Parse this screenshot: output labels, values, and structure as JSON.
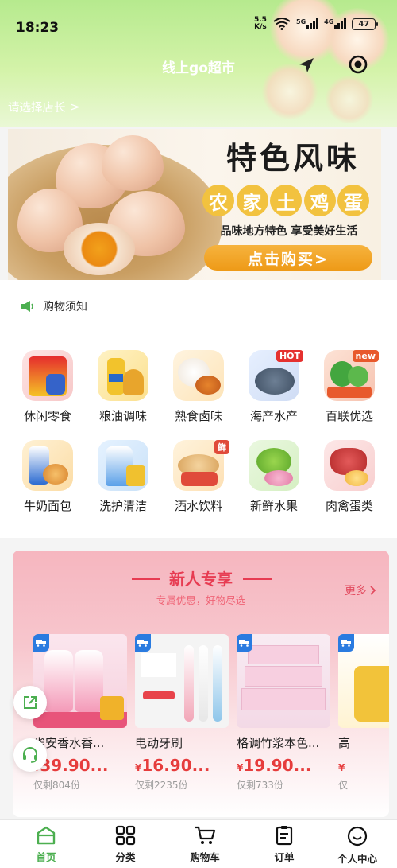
{
  "status_bar": {
    "time": "18:23",
    "net_speed_value": "5.5",
    "net_speed_unit": "K/s",
    "battery": "47",
    "network_labels": [
      "5G",
      "4G"
    ]
  },
  "header": {
    "title": "线上go超市",
    "store_select": "请选择店长",
    "chevron": ">"
  },
  "banner": {
    "title": "特色风味",
    "subtitle_chars": [
      "农",
      "家",
      "土",
      "鸡",
      "蛋"
    ],
    "slogan": "品味地方特色 享受美好生活",
    "cta": "点击购买>"
  },
  "notice": {
    "text": "购物须知"
  },
  "categories": [
    {
      "label": "休闲零食",
      "icon": "snacks-icon",
      "tag": ""
    },
    {
      "label": "粮油调味",
      "icon": "grain-oil-icon",
      "tag": ""
    },
    {
      "label": "熟食卤味",
      "icon": "cooked-food-icon",
      "tag": ""
    },
    {
      "label": "海产水产",
      "icon": "seafood-icon",
      "tag": "HOT"
    },
    {
      "label": "百联优选",
      "icon": "vegetables-icon",
      "tag": "new"
    },
    {
      "label": "牛奶面包",
      "icon": "milk-bread-icon",
      "tag": ""
    },
    {
      "label": "洗护清洁",
      "icon": "detergent-icon",
      "tag": ""
    },
    {
      "label": "酒水饮料",
      "icon": "drinks-icon",
      "tag": "鲜"
    },
    {
      "label": "新鲜水果",
      "icon": "fruit-icon",
      "tag": ""
    },
    {
      "label": "肉禽蛋类",
      "icon": "meat-egg-icon",
      "tag": ""
    }
  ],
  "new_user": {
    "title": "新人专享",
    "subtitle": "专属优惠，好物尽选",
    "more": "更多",
    "products": [
      {
        "name": "雀安香水香...",
        "yen": "¥",
        "price": "39.90...",
        "stock": "仅剩804份"
      },
      {
        "name": "电动牙刷",
        "yen": "¥",
        "price": "16.90...",
        "stock": "仅剩2235份"
      },
      {
        "name": "格调竹浆本色...",
        "yen": "¥",
        "price": "19.90...",
        "stock": "仅剩733份"
      },
      {
        "name": "高",
        "yen": "¥",
        "price": "",
        "stock": "仅"
      }
    ]
  },
  "tabbar": {
    "tabs": [
      {
        "label": "首页",
        "icon": "home-icon"
      },
      {
        "label": "分类",
        "icon": "category-grid-icon"
      },
      {
        "label": "购物车",
        "icon": "cart-icon"
      },
      {
        "label": "订单",
        "icon": "order-icon"
      },
      {
        "label": "个人中心",
        "icon": "profile-icon"
      }
    ]
  },
  "colors": {
    "header_green": "#b6ea8e",
    "active_tab": "#4caf50",
    "price_red": "#e63c3c",
    "section_pink": "#f6b6bf",
    "cta_orange": "#ee9a17"
  }
}
